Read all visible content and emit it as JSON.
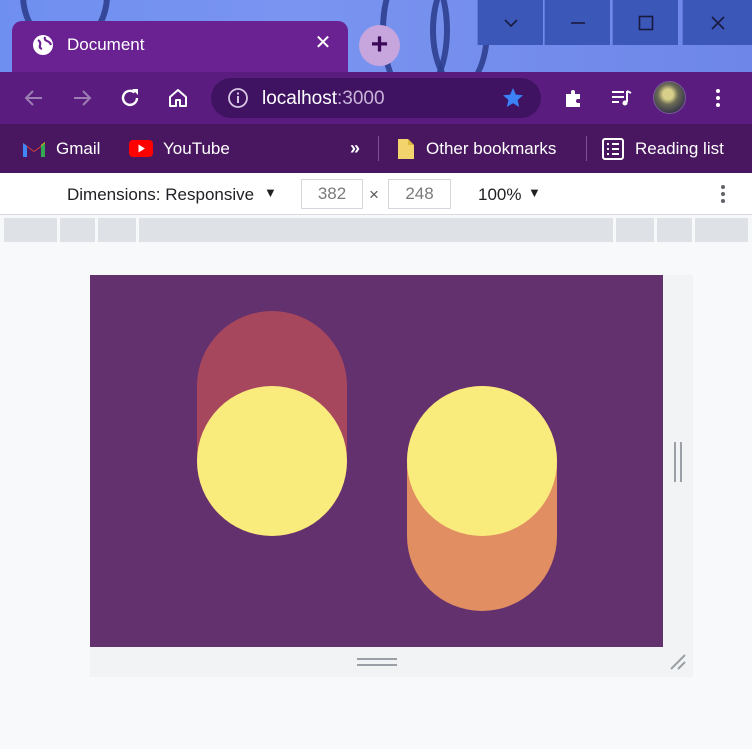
{
  "browser": {
    "tab": {
      "title": "Document",
      "icon": "globe-icon",
      "close_icon": "close-icon"
    },
    "new_tab_icon": "plus-icon",
    "window_controls": [
      "chevron-down-icon",
      "minimize-icon",
      "maximize-icon",
      "close-icon"
    ],
    "address": {
      "host": "localhost",
      "port": ":3000",
      "info_icon": "info-icon",
      "bookmark_icon": "star-icon"
    },
    "nav_icons": [
      "back-arrow-icon",
      "forward-arrow-icon",
      "reload-icon",
      "home-icon"
    ],
    "toolbar_icons": [
      "extensions-icon",
      "media-queue-icon",
      "avatar",
      "menu-icon"
    ]
  },
  "bookmarks": {
    "items": [
      {
        "label": "Gmail",
        "icon": "gmail-icon"
      },
      {
        "label": "YouTube",
        "icon": "youtube-icon"
      }
    ],
    "overflow": "»",
    "other": "Other bookmarks",
    "reading_list": "Reading list"
  },
  "devtools": {
    "dimensions_label": "Dimensions: Responsive",
    "width": "382",
    "times": "×",
    "height": "248",
    "zoom": "100%"
  },
  "colors": {
    "page_bg": "#64316f",
    "circle_yellow": "#f9ec7d",
    "pill_red": "#a7475d",
    "pill_orange": "#e18e62",
    "accent_star": "#3b82f6"
  }
}
